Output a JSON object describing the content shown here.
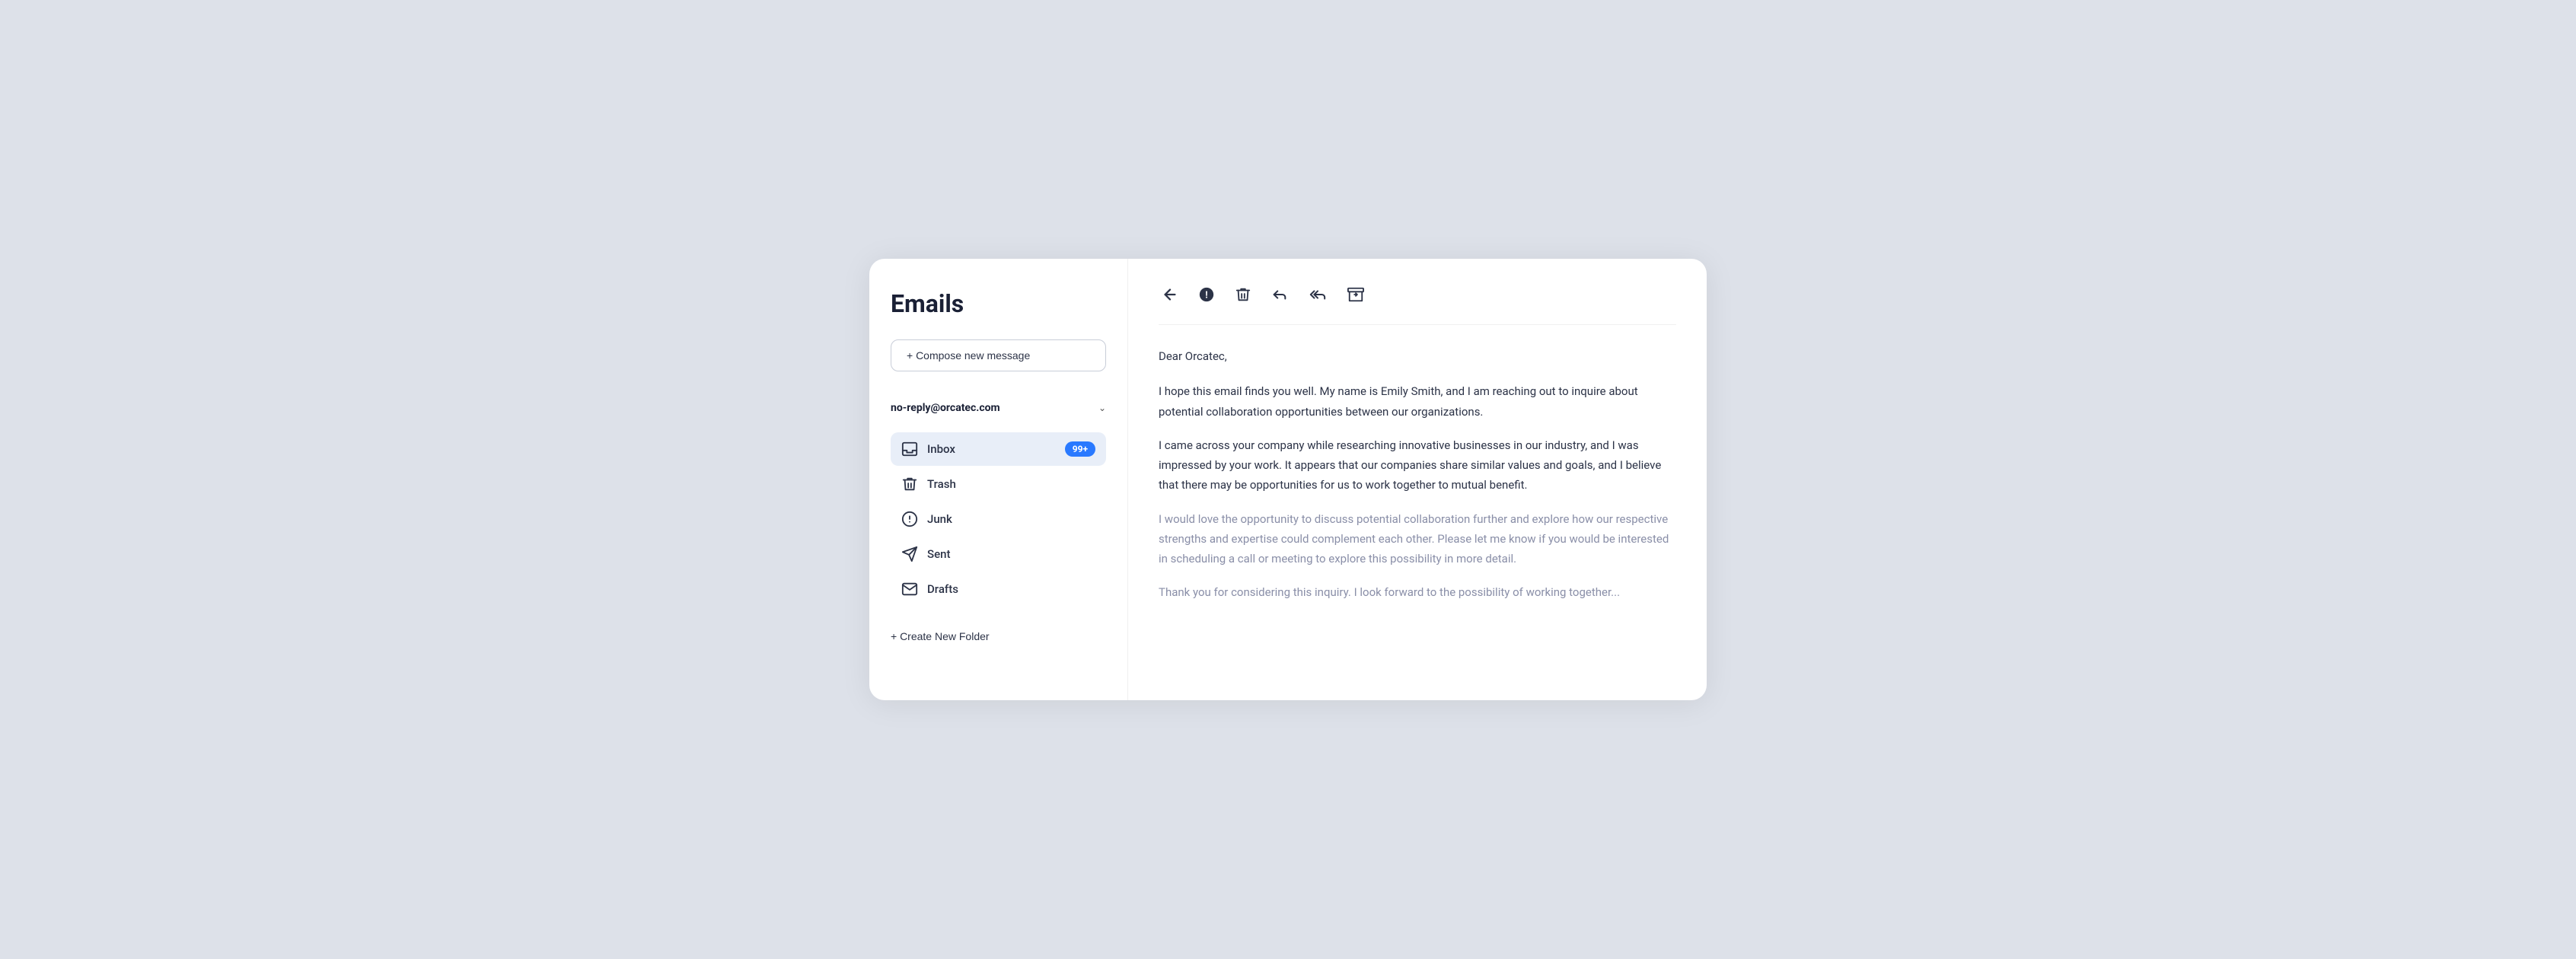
{
  "sidebar": {
    "title": "Emails",
    "compose_label": "+ Compose new message",
    "account": {
      "email": "no-reply@orcatec.com"
    },
    "folders": [
      {
        "id": "inbox",
        "label": "Inbox",
        "icon": "inbox",
        "badge": "99+",
        "active": true
      },
      {
        "id": "trash",
        "label": "Trash",
        "icon": "trash",
        "badge": null,
        "active": false
      },
      {
        "id": "junk",
        "label": "Junk",
        "icon": "junk",
        "badge": null,
        "active": false
      },
      {
        "id": "sent",
        "label": "Sent",
        "icon": "sent",
        "badge": null,
        "active": false
      },
      {
        "id": "drafts",
        "label": "Drafts",
        "icon": "drafts",
        "badge": null,
        "active": false
      }
    ],
    "create_folder_label": "+ Create New Folder"
  },
  "email": {
    "greeting": "Dear Orcatec,",
    "paragraphs": [
      "I hope this email finds you well. My name is Emily Smith, and I am reaching out to inquire about potential collaboration opportunities between our organizations.",
      "I came across your company while researching innovative businesses in our industry, and I was impressed by your work. It appears that our companies share similar values and goals, and I believe that there may be opportunities for us to work together to mutual benefit.",
      "I would love the opportunity to discuss potential collaboration further and explore how our respective strengths and expertise could complement each other. Please let me know if you would be interested in scheduling a call or meeting to explore this possibility in more detail.",
      "Thank you for considering this inquiry. I look forward to the possibility of working together..."
    ]
  },
  "toolbar": {
    "back_title": "Back",
    "alert_title": "Alert",
    "delete_title": "Delete",
    "reply_title": "Reply",
    "reply_all_title": "Reply All",
    "archive_title": "Archive"
  }
}
